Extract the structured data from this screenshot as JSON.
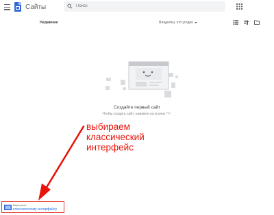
{
  "header": {
    "app_title": "Сайты",
    "search_placeholder": "Поиск"
  },
  "toolbar": {
    "section_title": "Недавние",
    "owner_filter": "Владелец: кто угодно"
  },
  "empty_state": {
    "title": "Создайте первый сайт",
    "hint": "Чтобы создать сайт, нажмите на значок \"+\"."
  },
  "annotation": {
    "line1": "выбираем",
    "line2": "классический",
    "line3": "интерфейс",
    "color": "#e8140a"
  },
  "classic_link": {
    "line1": "Вернуться",
    "line2": "классическому интерфейсу"
  },
  "colors": {
    "brand": "#3367d6",
    "annotation_red": "#e8140a"
  },
  "icons": [
    "menu-icon",
    "sites-logo-icon",
    "search-icon",
    "apps-grid-icon",
    "list-view-icon",
    "sort-icon",
    "folder-icon",
    "classic-sites-icon"
  ]
}
